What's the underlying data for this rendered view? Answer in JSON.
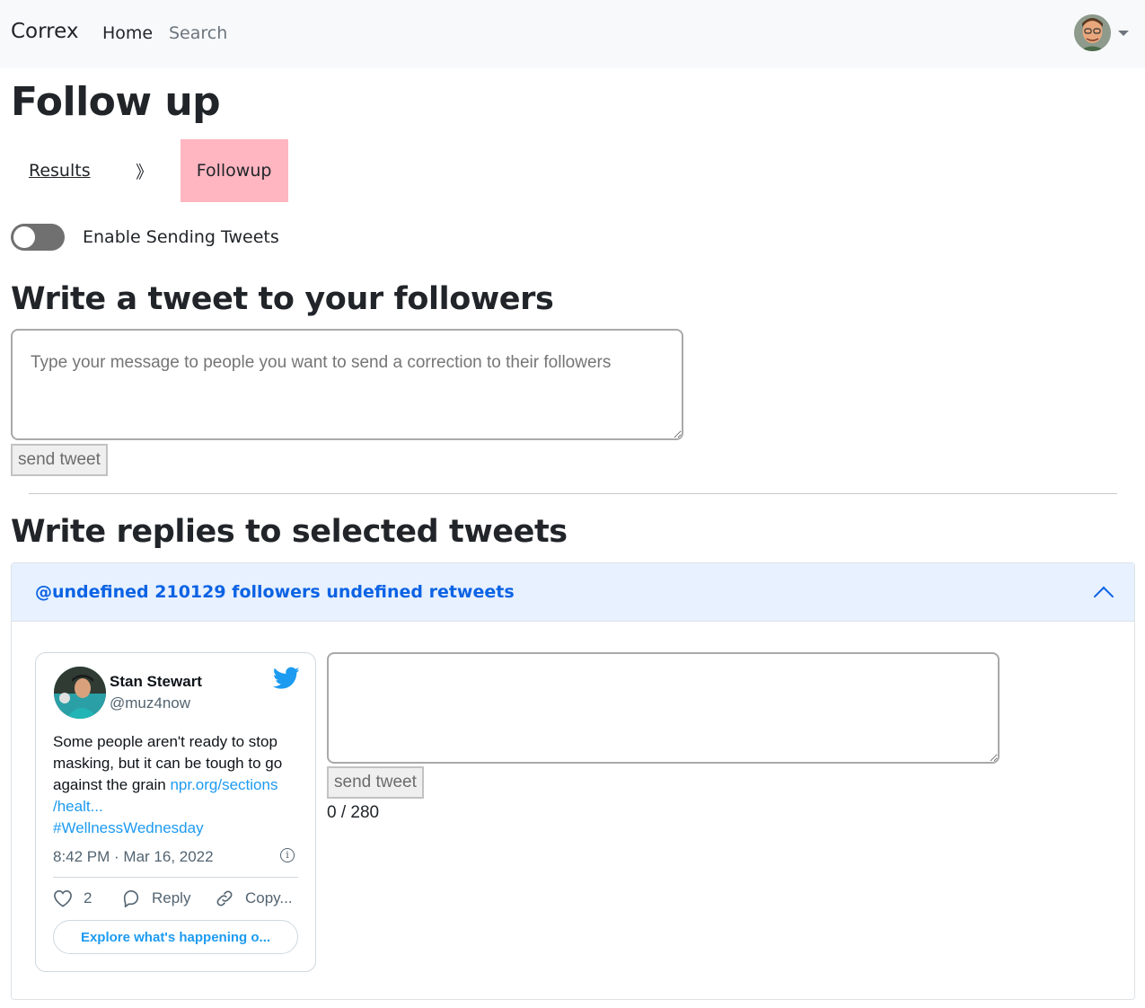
{
  "navbar": {
    "brand": "Correx",
    "links": [
      "Home",
      "Search"
    ]
  },
  "page": {
    "title": "Follow up"
  },
  "breadcrumb": {
    "results": "Results",
    "separator": "》",
    "current": "Followup",
    "current_bg": "#ffb6c1"
  },
  "toggle": {
    "label": "Enable Sending Tweets",
    "enabled": false
  },
  "tweet_to_followers": {
    "heading": "Write a tweet to your followers",
    "placeholder": "Type your message to people you want to send a correction to their followers",
    "value": "",
    "button": "send tweet"
  },
  "replies": {
    "heading": "Write replies to selected tweets",
    "accordion_title": "@undefined 210129 followers undefined retweets",
    "accordion_expanded": true,
    "tweet": {
      "name": "Stan Stewart",
      "handle": "@muz4now",
      "text": "Some people aren't ready to stop masking, but it can be tough to go against the grain",
      "link_1": "npr.org/sections",
      "link_2": "/healt...",
      "hashtag": "#WellnessWednesday",
      "timestamp": "8:42 PM · Mar 16, 2022",
      "likes": "2",
      "reply_label": "Reply",
      "copy_label": "Copy...",
      "explore_label": "Explore what's happening o..."
    },
    "reply_box": {
      "value": "",
      "button": "send tweet",
      "counter": "0 / 280"
    }
  },
  "colors": {
    "navbar_bg": "#f8f9fa",
    "accordion_header_bg": "#e7f1ff",
    "accordion_title": "#0c63e4",
    "twitter_blue": "#1d9bf0"
  },
  "icons": [
    "user-avatar",
    "caret-down-icon",
    "chevron-up-icon",
    "twitter-bird-icon",
    "info-icon",
    "heart-icon",
    "reply-icon",
    "link-icon"
  ]
}
